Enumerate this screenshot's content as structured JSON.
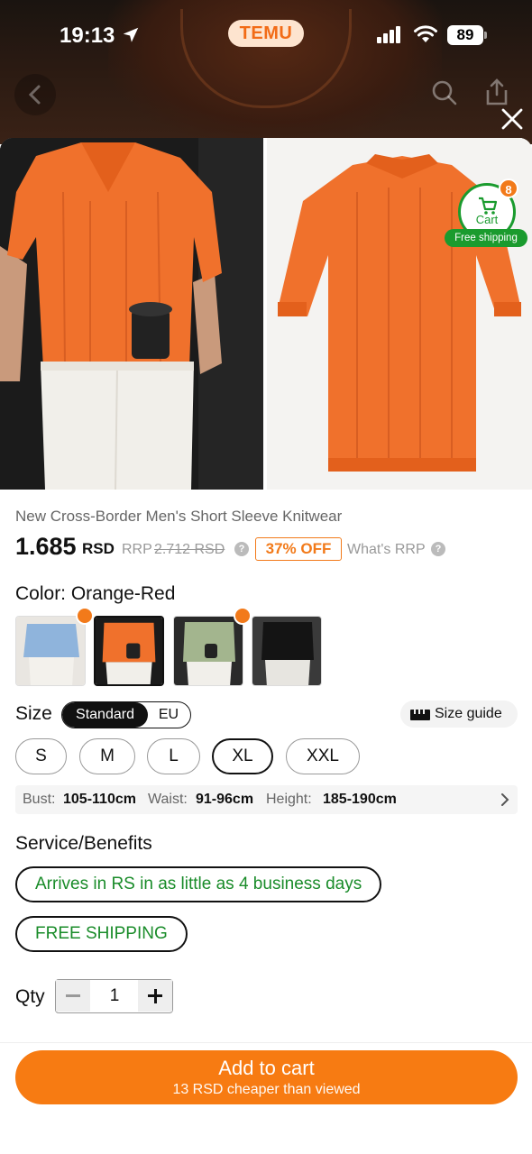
{
  "status_bar": {
    "time": "19:13",
    "app_pill": "TEMU",
    "battery": "89"
  },
  "cart": {
    "label": "Cart",
    "count": "8",
    "free_shipping": "Free shipping"
  },
  "product": {
    "title": "New Cross-Border Men's Short Sleeve Knitwear",
    "price": "1.685",
    "currency": "RSD",
    "rrp_label": "RRP",
    "rrp_value": "2.712 RSD",
    "discount": "37% OFF",
    "whats_rrp": "What's RRP"
  },
  "color": {
    "label": "Color: Orange-Red",
    "swatches": [
      {
        "name": "Light blue",
        "color": "#8fb4dc",
        "hot": true
      },
      {
        "name": "Orange-Red",
        "color": "#f0712c",
        "selected": true
      },
      {
        "name": "Sage green",
        "color": "#a3b58e",
        "hot": true
      },
      {
        "name": "Black",
        "color": "#1c1c1c"
      }
    ]
  },
  "size": {
    "label": "Size",
    "standards": [
      "Standard",
      "EU"
    ],
    "guide": "Size guide",
    "options": [
      "S",
      "M",
      "L",
      "XL",
      "XXL"
    ],
    "selected": "XL",
    "measurements": {
      "bust_k": "Bust:",
      "bust_v": "105-110cm",
      "waist_k": "Waist:",
      "waist_v": "91-96cm",
      "height_k": "Height:",
      "height_v": "185-190cm"
    }
  },
  "services": {
    "label": "Service/Benefits",
    "items": [
      "Arrives in RS in as little as 4 business days",
      "FREE SHIPPING"
    ]
  },
  "qty": {
    "label": "Qty",
    "value": "1"
  },
  "cta": {
    "label": "Add to cart",
    "sub": "13 RSD cheaper than viewed"
  },
  "colors": {
    "accent": "#f77b12",
    "green": "#1a8c2a"
  }
}
